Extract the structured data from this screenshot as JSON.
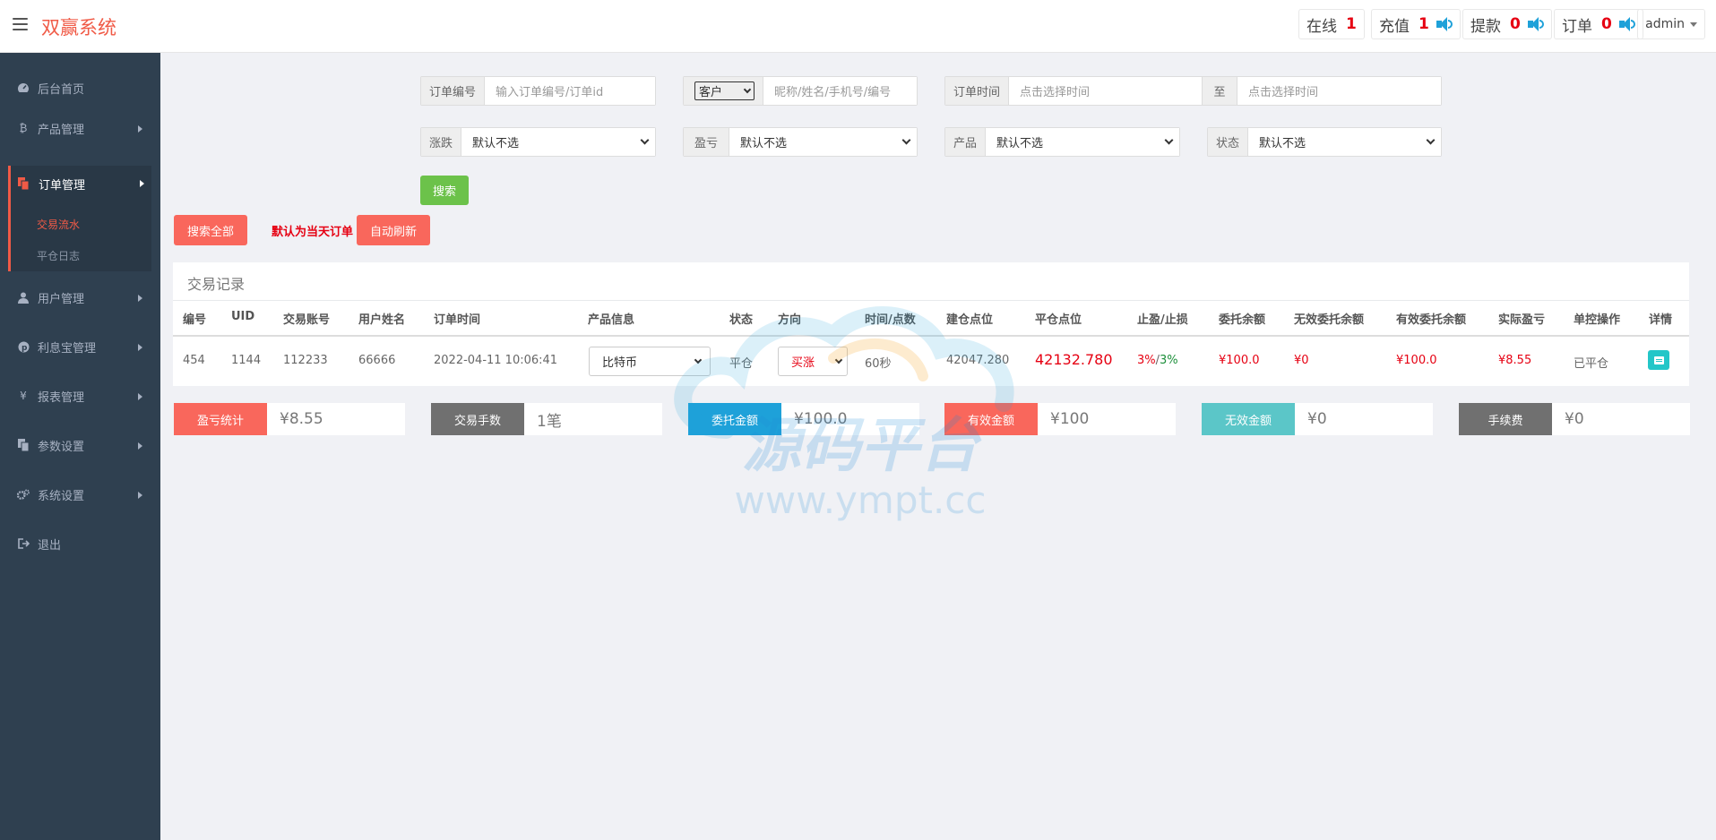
{
  "header": {
    "title": "双赢系统",
    "stats": [
      {
        "label": "在线",
        "value": "1",
        "sound": false
      },
      {
        "label": "充值",
        "value": "1",
        "sound": true
      },
      {
        "label": "提款",
        "value": "0",
        "sound": true
      },
      {
        "label": "订单",
        "value": "0",
        "sound": true
      }
    ],
    "user": "admin"
  },
  "sidebar": {
    "items": [
      {
        "label": "后台首页",
        "icon": "dashboard-icon"
      },
      {
        "label": "产品管理",
        "icon": "bitcoin-icon"
      },
      {
        "label": "订单管理",
        "icon": "copy-icon"
      },
      {
        "label": "用户管理",
        "icon": "user-icon"
      },
      {
        "label": "利息宝管理",
        "icon": "pinterest-icon"
      },
      {
        "label": "报表管理",
        "icon": "yen-icon"
      },
      {
        "label": "参数设置",
        "icon": "copy-icon"
      },
      {
        "label": "系统设置",
        "icon": "gears-icon"
      },
      {
        "label": "退出",
        "icon": "sign-out-icon"
      }
    ],
    "subitems": [
      {
        "label": "交易流水",
        "active": true
      },
      {
        "label": "平仓日志",
        "active": false
      }
    ]
  },
  "filters": {
    "order_no_label": "订单编号",
    "order_no_placeholder": "输入订单编号/订单id",
    "customer_select": "客户",
    "customer_placeholder": "昵称/姓名/手机号/编号",
    "order_time_label": "订单时间",
    "time_start_placeholder": "点击选择时间",
    "to_label": "至",
    "time_end_placeholder": "点击选择时间",
    "rise_fall_label": "涨跌",
    "rise_fall_value": "默认不选",
    "profit_label": "盈亏",
    "profit_value": "默认不选",
    "product_label": "产品",
    "product_value": "默认不选",
    "status_label": "状态",
    "status_value": "默认不选",
    "search_button": "搜索",
    "search_all_button": "搜索全部",
    "default_note": "默认为当天订单",
    "auto_refresh_button": "自动刷新"
  },
  "table": {
    "title": "交易记录",
    "columns": [
      "编号",
      "UID",
      "交易账号",
      "用户姓名",
      "订单时间",
      "产品信息",
      "状态",
      "方向",
      "时间/点数",
      "建仓点位",
      "平仓点位",
      "止盈/止损",
      "委托余额",
      "无效委托余额",
      "有效委托余额",
      "实际盈亏",
      "单控操作",
      "详情"
    ],
    "rows": [
      {
        "id": "454",
        "uid": "1144",
        "account": "112233",
        "name": "66666",
        "time": "2022-04-11 10:06:41",
        "product": "比特币",
        "status": "平仓",
        "direction": "买涨",
        "duration": "60秒",
        "open_price": "42047.280",
        "close_price": "42132.780",
        "take_profit": "3%",
        "stop_loss": "3%",
        "amount": "¥100.0",
        "invalid_amount": "¥0",
        "valid_amount": "¥100.0",
        "profit": "¥8.55",
        "control": "已平仓"
      }
    ]
  },
  "summary": [
    {
      "label": "盈亏统计",
      "value": "¥8.55",
      "color": "#f9675c"
    },
    {
      "label": "交易手数",
      "value": "1笔",
      "color": "#707070"
    },
    {
      "label": "委托金额",
      "value": "¥100.0",
      "color": "#1ea1d9"
    },
    {
      "label": "有效金额",
      "value": "¥100",
      "color": "#f9675c"
    },
    {
      "label": "无效金额",
      "value": "¥0",
      "color": "#5bc6c8"
    },
    {
      "label": "手续费",
      "value": "¥0",
      "color": "#707070"
    }
  ],
  "watermark": {
    "text": "源码平台",
    "url": "www.ympt.cc"
  },
  "colors": {
    "accent": "#f05a46",
    "sidebar": "#2f4050",
    "green": "#6cc24a",
    "red": "#e60012"
  }
}
